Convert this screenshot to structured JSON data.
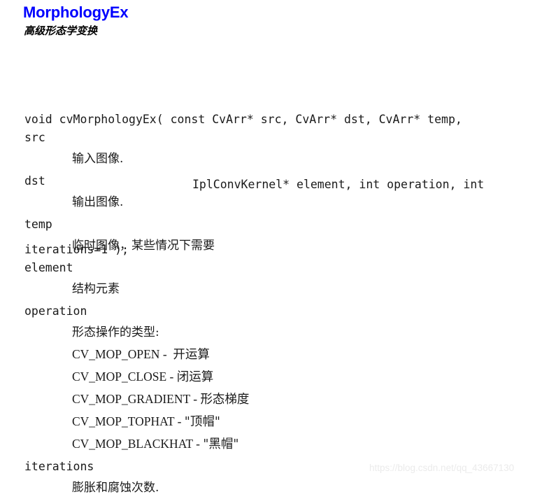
{
  "header": {
    "title": "MorphologyEx",
    "subtitle": "高级形态学变换",
    "title_color": "#0000ff"
  },
  "signature": {
    "lines": [
      "void cvMorphologyEx( const CvArr* src, CvArr* dst, CvArr* temp,",
      "IplConvKernel* element, int operation, int",
      "iterations=1 );"
    ]
  },
  "parameters": [
    {
      "name": "src",
      "description": "输入图像."
    },
    {
      "name": "dst",
      "description": "输出图像."
    },
    {
      "name": "temp",
      "description": "临时图像，某些情况下需要"
    },
    {
      "name": "element",
      "description": "结构元素"
    },
    {
      "name": "operation",
      "description": "形态操作的类型:"
    },
    {
      "name": "iterations",
      "description": "膨胀和腐蚀次数."
    }
  ],
  "operation_constants": [
    {
      "name": "CV_MOP_OPEN",
      "separator": " -  ",
      "meaning": "开运算"
    },
    {
      "name": "CV_MOP_CLOSE",
      "separator": " - ",
      "meaning": "闭运算"
    },
    {
      "name": "CV_MOP_GRADIENT",
      "separator": " - ",
      "meaning": "形态梯度"
    },
    {
      "name": "CV_MOP_TOPHAT",
      "separator": " - ",
      "meaning": "\"顶帽\""
    },
    {
      "name": "CV_MOP_BLACKHAT",
      "separator": " - ",
      "meaning": "\"黑帽\""
    }
  ],
  "watermark": {
    "text": "https://blog.csdn.net/qq_43667130"
  }
}
